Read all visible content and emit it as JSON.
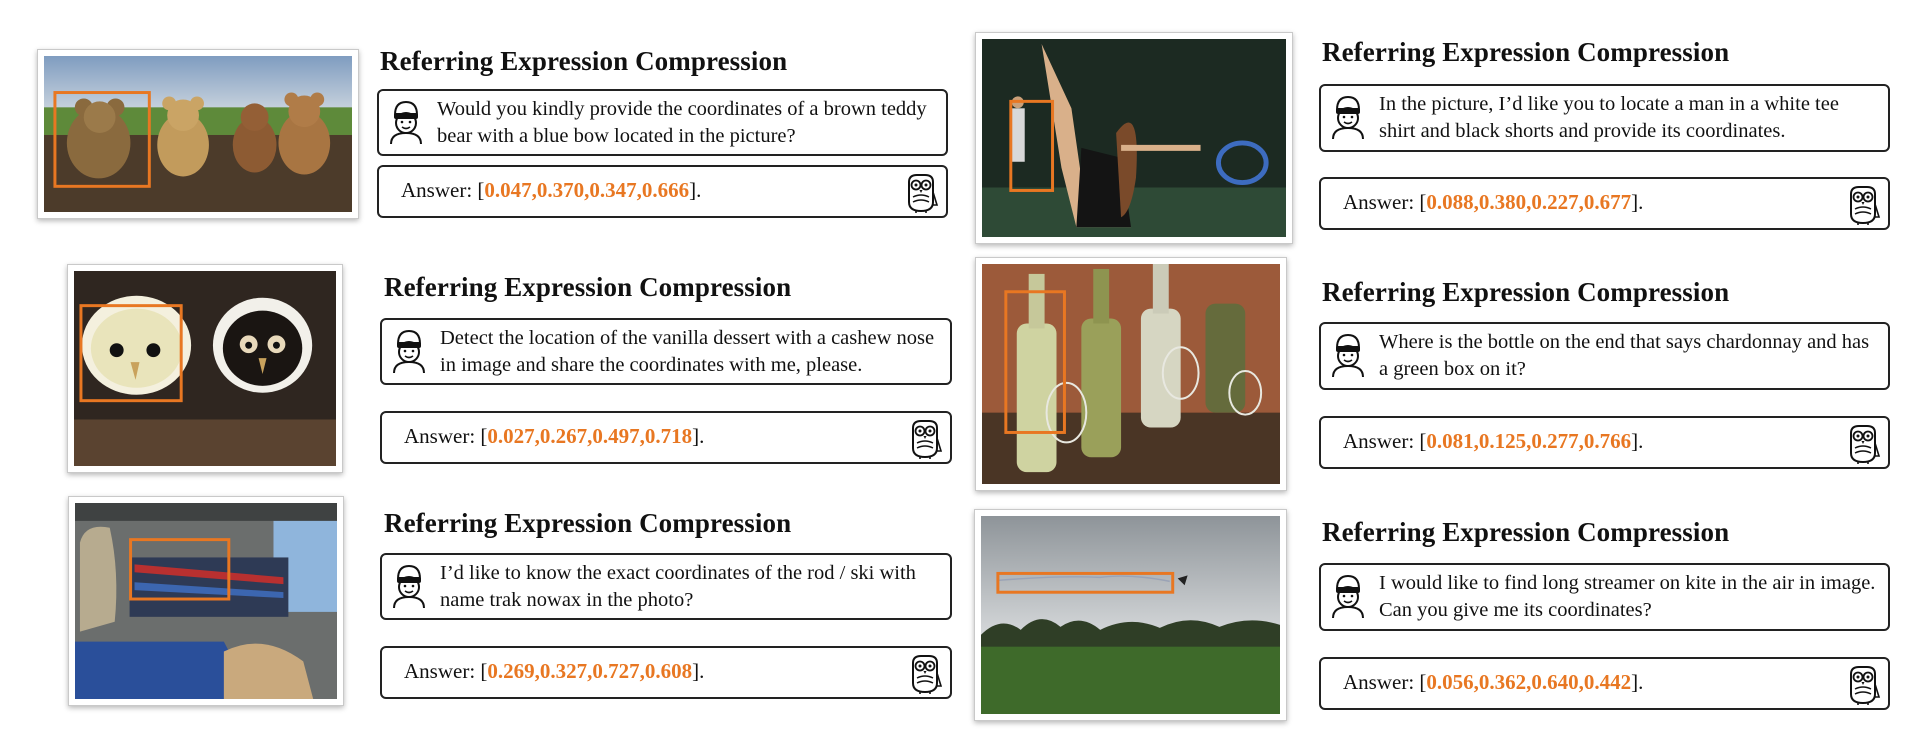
{
  "accent_color": "#e87722",
  "icons": {
    "question": "person-icon",
    "answer": "owl-icon"
  },
  "panels": [
    {
      "title": "Referring Expression Compression",
      "question": "Would you kindly provide the coordinates of a brown teddy bear with a blue bow located in the picture?",
      "answer_prefix": "Answer: [",
      "answer_coords": "0.047,0.370,0.347,0.666",
      "answer_suffix": "]."
    },
    {
      "title": "Referring Expression Compression",
      "question": "Detect the location of the vanilla dessert with a cashew nose in image and share the coordinates with me, please.",
      "answer_prefix": "Answer: [",
      "answer_coords": "0.027,0.267,0.497,0.718",
      "answer_suffix": "]."
    },
    {
      "title": "Referring Expression Compression",
      "question": "I’d like to know the exact coordinates of the rod / ski with name trak nowax in the photo?",
      "answer_prefix": "Answer: [",
      "answer_coords": "0.269,0.327,0.727,0.608",
      "answer_suffix": "]."
    },
    {
      "title": "Referring Expression Compression",
      "question": "In the picture, I’d like you to locate a man in a white tee shirt and black shorts and provide its coordinates.",
      "answer_prefix": "Answer: [",
      "answer_coords": "0.088,0.380,0.227,0.677",
      "answer_suffix": "]."
    },
    {
      "title": "Referring Expression Compression",
      "question": "Where is the bottle on the end that says chardonnay and has a green box on it?",
      "answer_prefix": "Answer: [",
      "answer_coords": "0.081,0.125,0.277,0.766",
      "answer_suffix": "]."
    },
    {
      "title": "Referring Expression Compression",
      "question": "I would like to find long streamer on kite in the air in image. Can you give me its coordinates?",
      "answer_prefix": "Answer: [",
      "answer_coords": "0.056,0.362,0.640,0.442",
      "answer_suffix": "]."
    }
  ]
}
